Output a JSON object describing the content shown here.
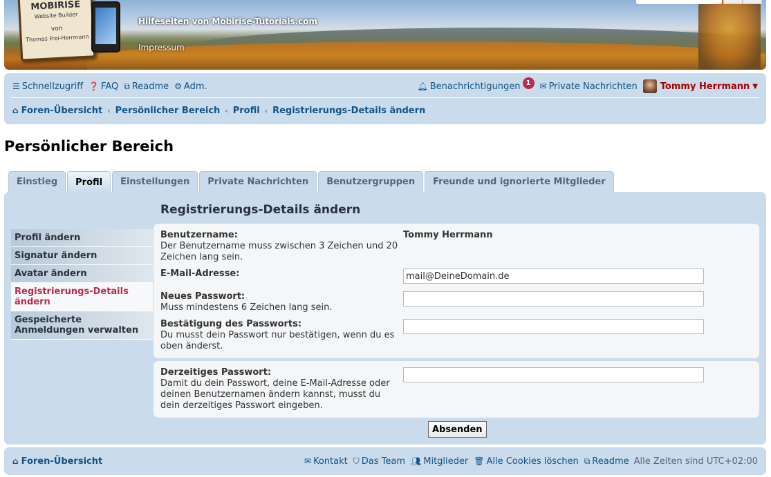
{
  "header": {
    "site_title": "Hilfeseiten von Mobirise-Tutorials.com",
    "impressum": "Impressum",
    "logo": {
      "title": "MOBIRISE",
      "subtitle": "Website Builder",
      "by": "von",
      "author": "Thomas Frei-Herrmann"
    }
  },
  "nav": {
    "quicklinks_label": "Schnellzugriff",
    "faq_label": "FAQ",
    "readme_label": "Readme",
    "admin_label": "Adm.",
    "notifications_label": "Benachrichtigungen",
    "notifications_count": "1",
    "pm_label": "Private Nachrichten",
    "username": "Tommy Herrmann"
  },
  "breadcrumb": [
    {
      "label": "Foren-Übersicht"
    },
    {
      "label": "Persönlicher Bereich"
    },
    {
      "label": "Profil"
    },
    {
      "label": "Registrierungs-Details ändern"
    }
  ],
  "page": {
    "title": "Persönlicher Bereich"
  },
  "tabs": [
    {
      "label": "Einstieg",
      "active": false
    },
    {
      "label": "Profil",
      "active": true
    },
    {
      "label": "Einstellungen",
      "active": false
    },
    {
      "label": "Private Nachrichten",
      "active": false
    },
    {
      "label": "Benutzergruppen",
      "active": false
    },
    {
      "label": "Freunde und ignorierte Mitglieder",
      "active": false
    }
  ],
  "sidemenu": [
    {
      "label": "Profil ändern",
      "active": false
    },
    {
      "label": "Signatur ändern",
      "active": false
    },
    {
      "label": "Avatar ändern",
      "active": false
    },
    {
      "label": "Registrierungs-Details ändern",
      "active": true
    },
    {
      "label": "Gespeicherte Anmeldungen verwalten",
      "active": false
    }
  ],
  "form": {
    "title": "Registrierungs-Details ändern",
    "username_label": "Benutzername:",
    "username_hint": "Der Benutzername muss zwischen 3 Zeichen und 20 Zeichen lang sein.",
    "username_value": "Tommy Herrmann",
    "email_label": "E-Mail-Adresse:",
    "email_value": "mail@DeineDomain.de",
    "new_password_label": "Neues Passwort:",
    "new_password_hint": "Muss mindestens 6 Zeichen lang sein.",
    "new_password_value": "",
    "confirm_password_label": "Bestätigung des Passworts:",
    "confirm_password_hint": "Du musst dein Passwort nur bestätigen, wenn du es oben änderst.",
    "confirm_password_value": "",
    "current_password_label": "Derzeitiges Passwort:",
    "current_password_hint": "Damit du dein Passwort, deine E-Mail-Adresse oder deinen Benutzernamen ändern kannst, musst du dein derzeitiges Passwort eingeben.",
    "current_password_value": "",
    "submit_label": "Absenden"
  },
  "footer": {
    "index_label": "Foren-Übersicht",
    "contact_label": "Kontakt",
    "team_label": "Das Team",
    "members_label": "Mitglieder",
    "cookies_label": "Alle Cookies löschen",
    "readme_label": "Readme",
    "timezone_text": "Alle Zeiten sind UTC+02:00"
  },
  "colors": {
    "panel_bg": "#cadceb",
    "link": "#105289",
    "username": "#aa0000",
    "badge": "#bc2a4d"
  }
}
